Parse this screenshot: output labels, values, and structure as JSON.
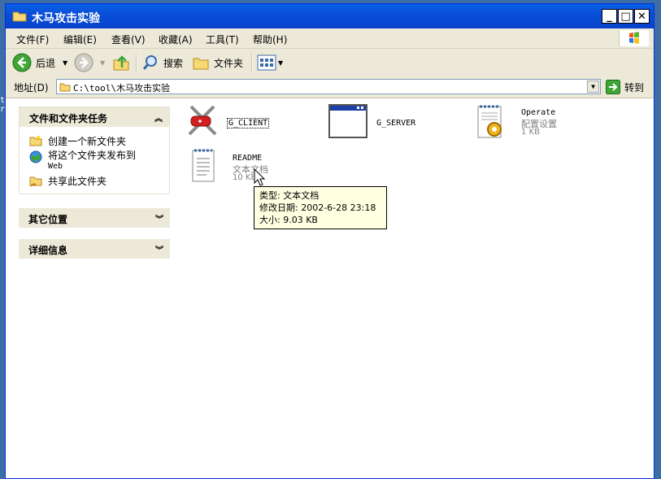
{
  "window": {
    "title": "木马攻击实验"
  },
  "title_buttons": {
    "minimize": "_",
    "maximize": "□",
    "close": "✕"
  },
  "menu": {
    "items": [
      {
        "label": "文件(F)"
      },
      {
        "label": "编辑(E)"
      },
      {
        "label": "查看(V)"
      },
      {
        "label": "收藏(A)"
      },
      {
        "label": "工具(T)"
      },
      {
        "label": "帮助(H)"
      }
    ]
  },
  "toolbar": {
    "back_label": "后退",
    "search_label": "搜索",
    "folders_label": "文件夹"
  },
  "address": {
    "label": "地址(D)",
    "path": "C:\\tool\\木马攻击实验",
    "go_label": "转到"
  },
  "left_pane": {
    "tasks_panel": {
      "title": "文件和文件夹任务",
      "items": [
        {
          "label": "创建一个新文件夹",
          "icon": "new-folder-icon"
        },
        {
          "label": "将这个文件夹发布到",
          "label2": "Web",
          "icon": "web-publish-icon"
        },
        {
          "label": "共享此文件夹",
          "icon": "share-folder-icon"
        }
      ]
    },
    "other_places_title": "其它位置",
    "details_title": "详细信息"
  },
  "files": [
    {
      "name": "G_CLIENT",
      "icon": "knife-tool-icon"
    },
    {
      "name": "G_SERVER",
      "icon": "window-app-icon"
    },
    {
      "name": "Operate",
      "type": "配置设置",
      "size": "1 KB",
      "icon": "config-settings-icon"
    },
    {
      "name": "README",
      "type": "文本文档",
      "size": "10 KB",
      "icon": "text-document-icon"
    }
  ],
  "tooltip": {
    "type_line": "类型: 文本文档",
    "modified_line": "修改日期: 2002-6-28 23:18",
    "size_line": "大小: 9.03 KB"
  },
  "colors": {
    "title_bar": "#0a4fd8",
    "chrome": "#ece9d8",
    "desktop": "#3a6ea5",
    "tooltip_bg": "#ffffe1"
  }
}
